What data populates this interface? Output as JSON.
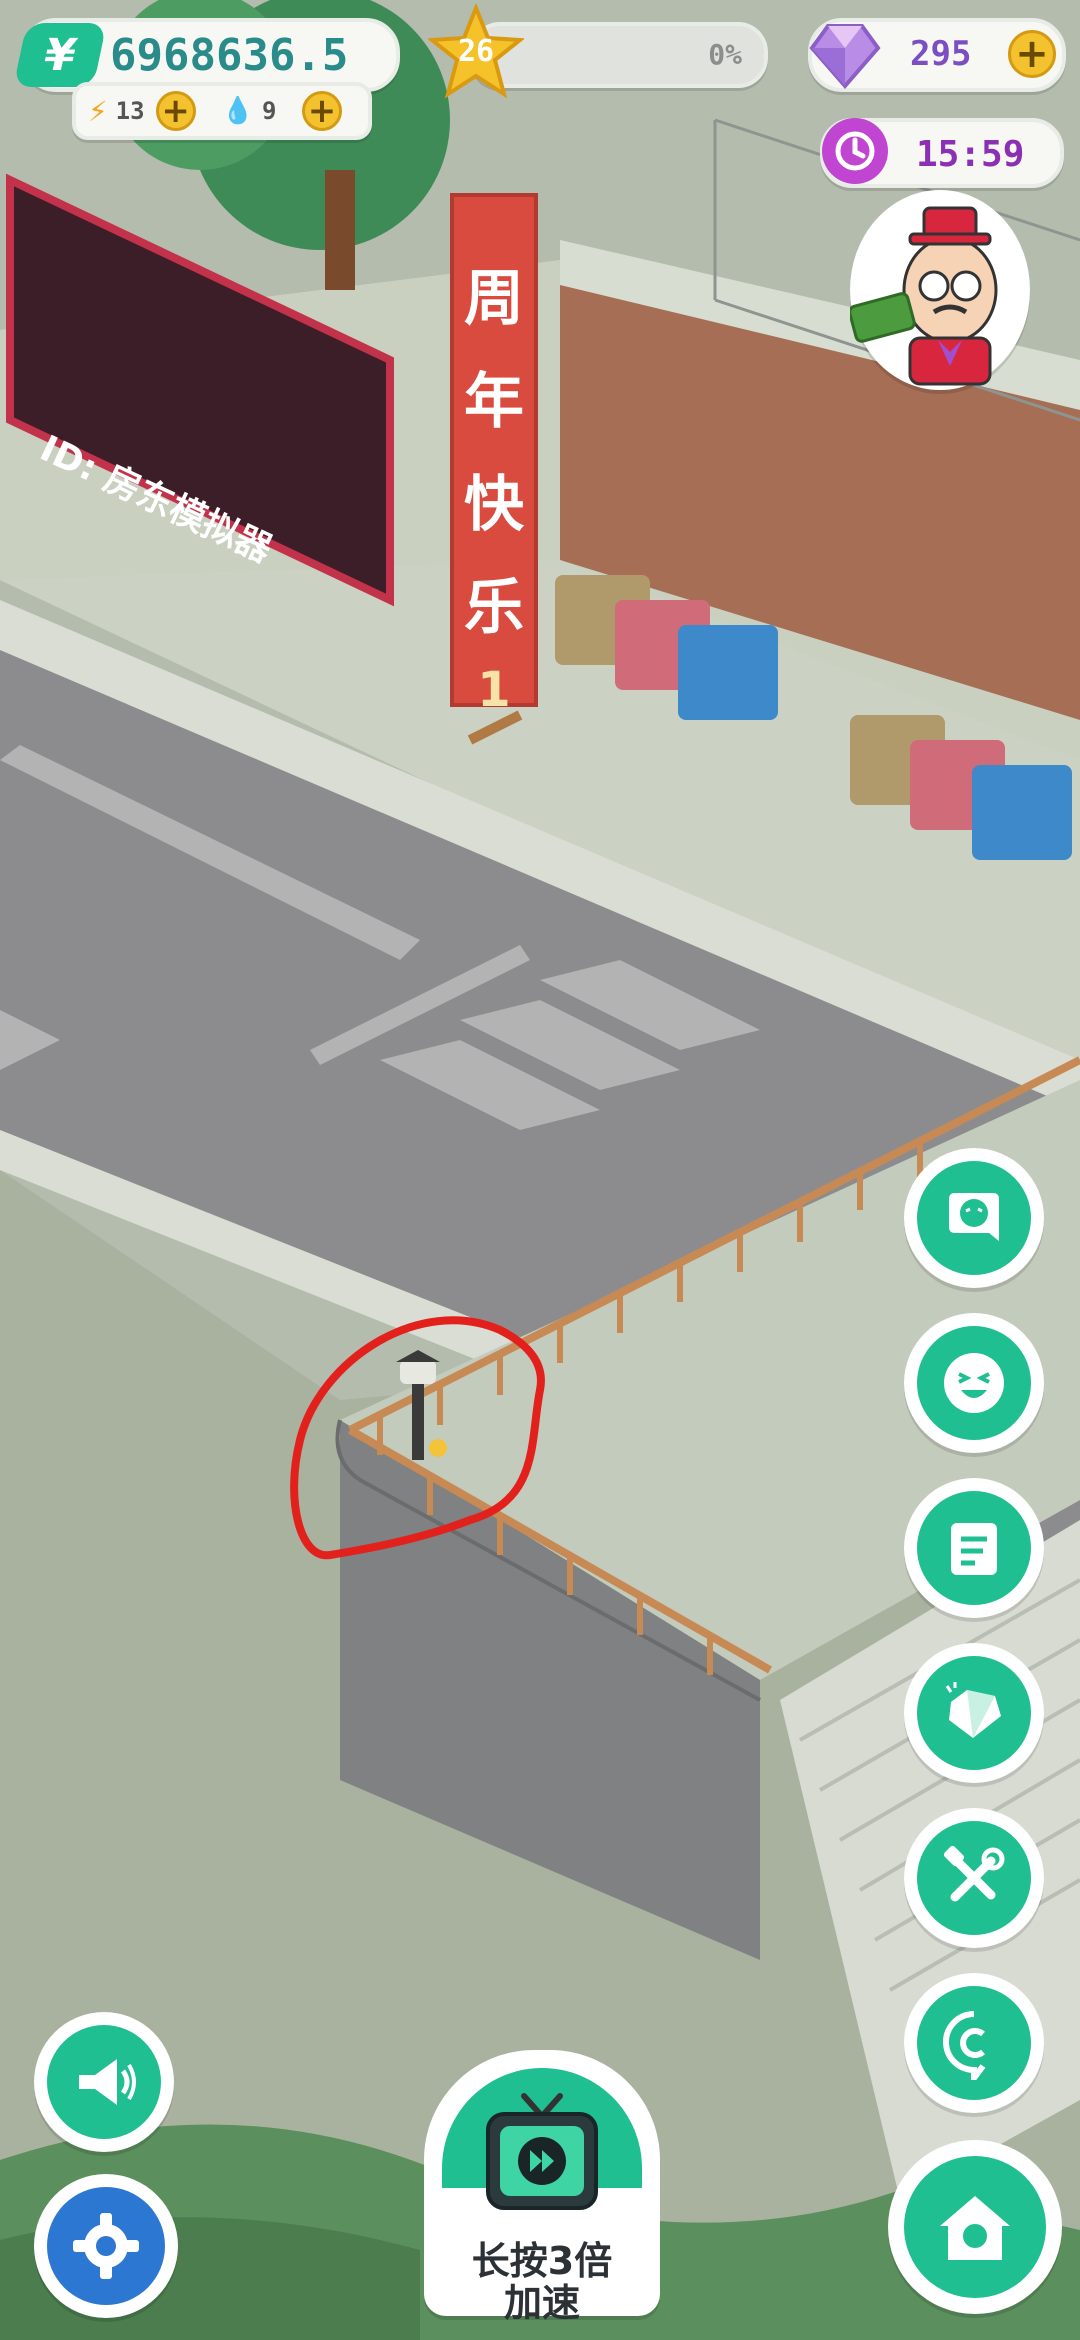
{
  "hud": {
    "money": "6968636.5",
    "money_icon": "yen-icon",
    "energy": "13",
    "water": "9",
    "level": "26",
    "level_progress": "0%",
    "level_progress_value": 0,
    "gems": "295",
    "timer": "15:59"
  },
  "scene": {
    "billboard_text": "ID: 房东模拟器",
    "banner_chars": [
      "周",
      "年",
      "快",
      "乐"
    ],
    "banner_number": "1"
  },
  "side_buttons": [
    {
      "name": "chat-bubble-button",
      "icon": "chat-ghost-icon"
    },
    {
      "name": "emoji-button",
      "icon": "smile-face-icon"
    },
    {
      "name": "notes-button",
      "icon": "notepad-icon"
    },
    {
      "name": "gem-shop-button",
      "icon": "diamond-icon"
    },
    {
      "name": "tools-button",
      "icon": "wrench-hammer-icon"
    },
    {
      "name": "copyright-button",
      "icon": "copyright-c-icon"
    }
  ],
  "bottom": {
    "speed_label_line1": "长按3倍",
    "speed_label_line2": "加速"
  },
  "colors": {
    "accent_green": "#1fbf92",
    "money_text": "#2a8c8a",
    "gem_text": "#7b4fc2",
    "timer_text": "#8b2fb4",
    "annotation_red": "#e3211c"
  }
}
